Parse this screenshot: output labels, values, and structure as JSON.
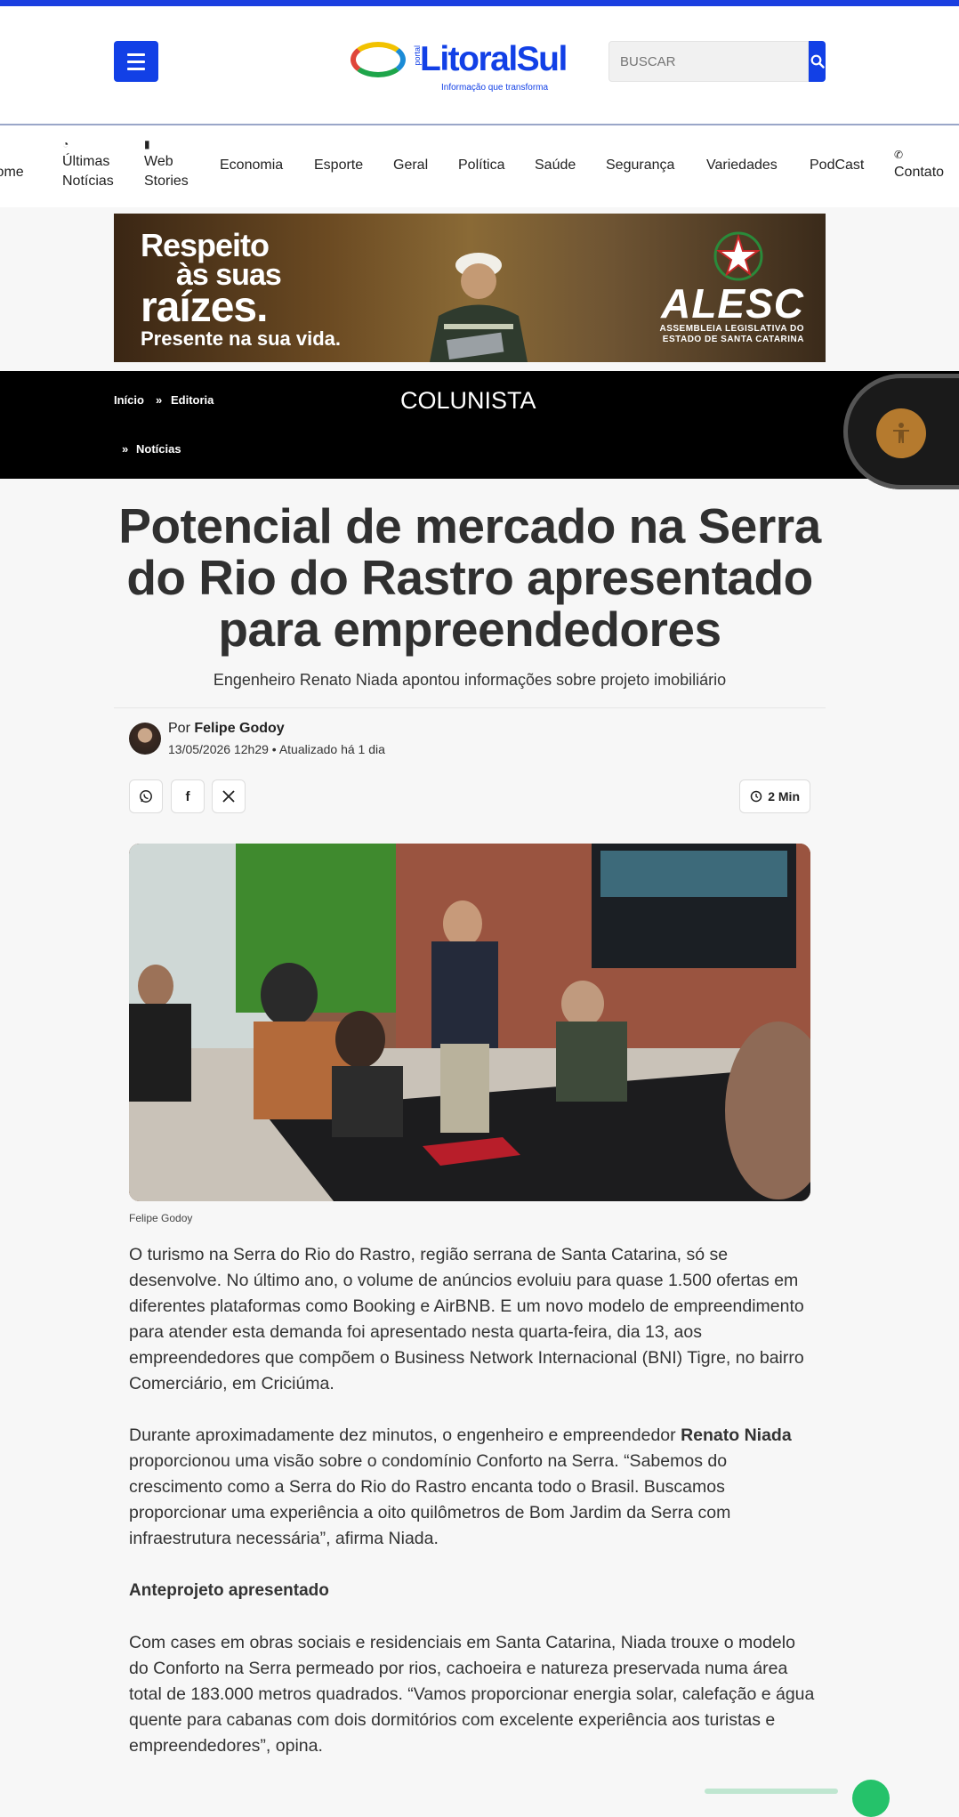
{
  "header": {
    "logo": {
      "portal": "portal",
      "name": "LitoralSul",
      "tagline": "Informação que transforma"
    },
    "search": {
      "placeholder": "BUSCAR"
    },
    "colors": {
      "brand": "#1240e6",
      "top_strip": "#1a3fe0"
    }
  },
  "nav": {
    "items": [
      {
        "label": "Home",
        "icon": "home-icon"
      },
      {
        "label": "Últimas Notícias",
        "icon": "rss-icon"
      },
      {
        "label": "Web Stories",
        "icon": "story-icon"
      },
      {
        "label": "Economia"
      },
      {
        "label": "Esporte"
      },
      {
        "label": "Geral"
      },
      {
        "label": "Política"
      },
      {
        "label": "Saúde"
      },
      {
        "label": "Segurança"
      },
      {
        "label": "Variedades"
      },
      {
        "label": "PodCast"
      },
      {
        "label": "Contato",
        "icon": "phone-icon"
      }
    ]
  },
  "banner": {
    "line1": "Respeito",
    "line2": "às suas",
    "line3": "raízes.",
    "line4": "Presente na sua vida.",
    "brand": "ALESC",
    "brand_sub1": "ASSEMBLEIA LEGISLATIVA DO",
    "brand_sub2": "ESTADO DE SANTA CATARINA"
  },
  "breadcrumb": {
    "home": "Início",
    "editoria": "Editoria",
    "noticias": "Notícias",
    "section_title": "COLUNISTA"
  },
  "article": {
    "title": "Potencial de mercado na Serra do Rio do Rastro apresentado para empreendedores",
    "subtitle": "Engenheiro Renato Niada apontou informações sobre projeto imobiliário",
    "by_prefix": "Por",
    "author": "Felipe Godoy",
    "published": "13/05/2026 12h29",
    "updated": "Atualizado há 1 dia",
    "read_time": "2 Min",
    "photo_credit": "Felipe Godoy",
    "paragraph1": "O turismo na Serra do Rio do Rastro, região serrana de Santa Catarina, só se desenvolve. No último ano, o volume de anúncios evoluiu para quase 1.500 ofertas em diferentes plataformas como Booking e AirBNB. E um novo modelo de empreendimento para atender esta demanda foi apresentado nesta quarta-feira, dia 13, aos empreendedores que compõem o Business Network Internacional (BNI) Tigre, no bairro Comerciário, em Criciúma.",
    "paragraph2_a": "Durante aproximadamente dez minutos, o engenheiro e empreendedor ",
    "paragraph2_bold": "Renato Niada",
    "paragraph2_b": " proporcionou uma visão sobre o condomínio Conforto na Serra. “Sabemos do crescimento como a Serra do Rio do Rastro encanta todo o Brasil. Buscamos proporcionar uma experiência a oito quilômetros de Bom Jardim da Serra com infraestrutura necessária”, afirma Niada.",
    "heading1": "Anteprojeto apresentado",
    "paragraph3": "Com cases em obras sociais e residenciais em Santa Catarina, Niada trouxe o modelo do Conforto na Serra permeado por rios, cachoeira e natureza preservada numa área total de 183.000 metros quadrados. “Vamos proporcionar energia solar, calefação e água quente para cabanas com dois dormitórios com excelente experiência aos turistas e empreendedores”, opina."
  },
  "share": {
    "whatsapp": "whatsapp-icon",
    "facebook": "facebook-icon",
    "x": "x-icon"
  }
}
